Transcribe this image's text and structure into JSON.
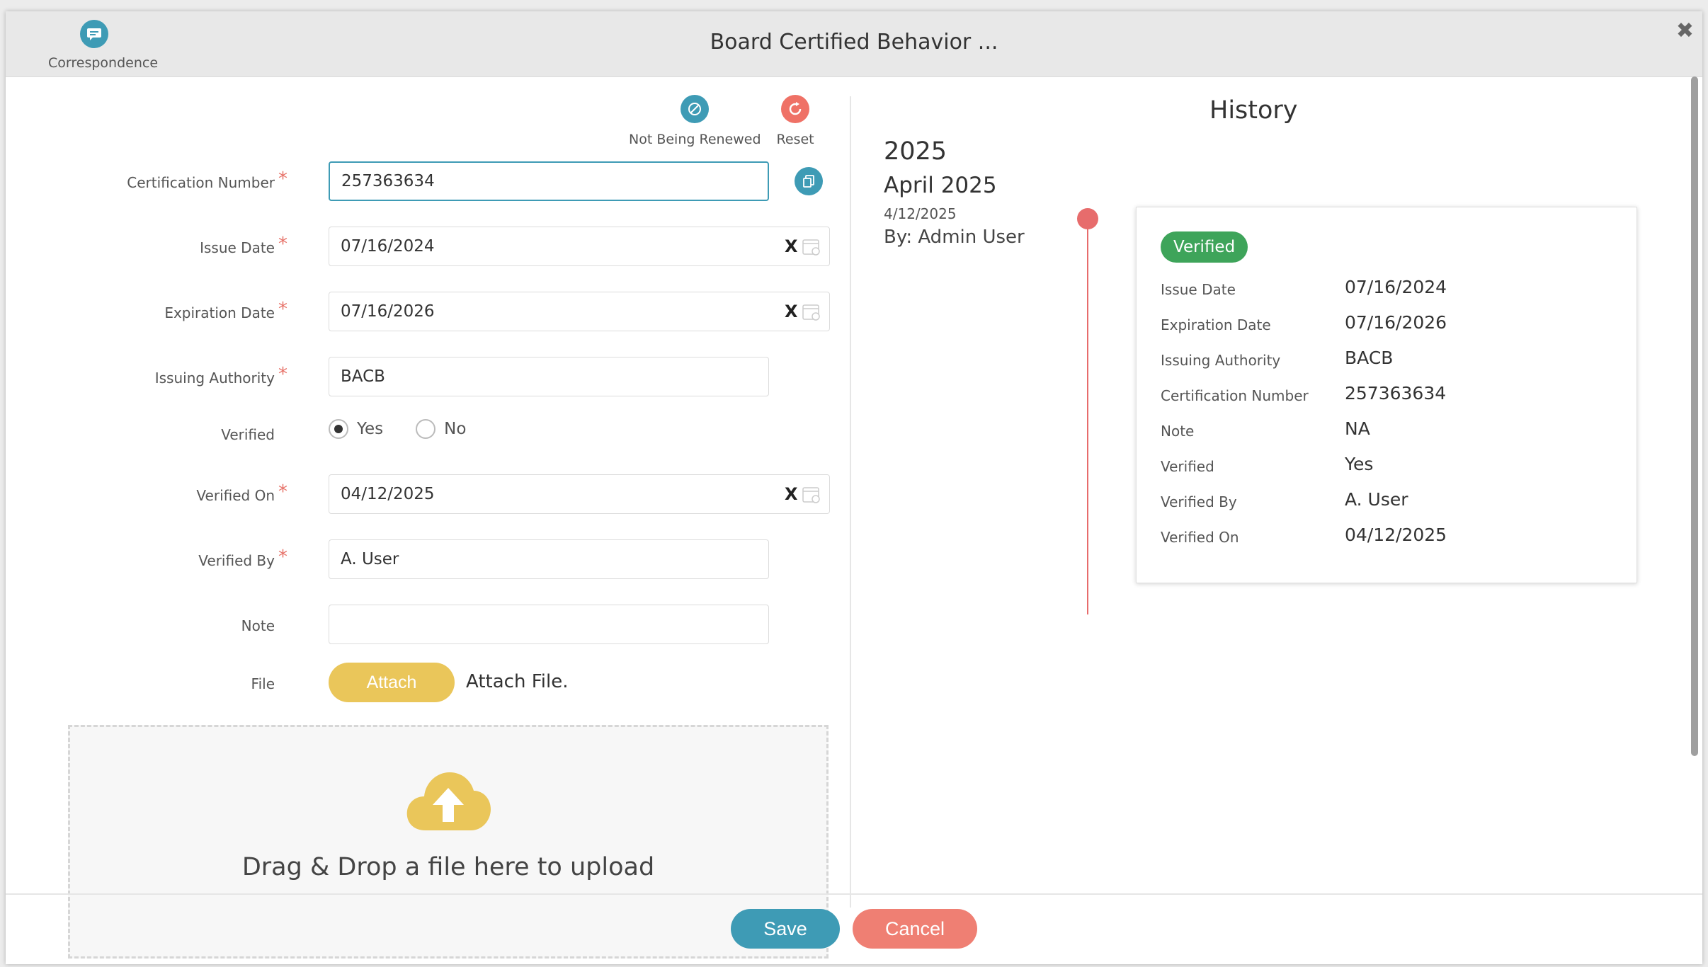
{
  "header": {
    "correspondence_label": "Correspondence",
    "title": "Board Certified Behavior ...",
    "close_icon": "close-icon"
  },
  "top_actions": {
    "not_renewed_label": "Not Being Renewed",
    "reset_label": "Reset"
  },
  "form": {
    "certification_number": {
      "label": "Certification Number",
      "value": "257363634",
      "required": "*"
    },
    "issue_date": {
      "label": "Issue Date",
      "value": "07/16/2024",
      "required": "*",
      "clear": "X"
    },
    "expiration_date": {
      "label": "Expiration Date",
      "value": "07/16/2026",
      "required": "*",
      "clear": "X"
    },
    "issuing_authority": {
      "label": "Issuing Authority",
      "value": "BACB",
      "required": "*"
    },
    "verified": {
      "label": "Verified",
      "yes": "Yes",
      "no": "No",
      "selected": "Yes"
    },
    "verified_on": {
      "label": "Verified On",
      "value": "04/12/2025",
      "required": "*",
      "clear": "X"
    },
    "verified_by": {
      "label": "Verified By",
      "value": "A. User",
      "required": "*"
    },
    "note": {
      "label": "Note",
      "value": ""
    },
    "file": {
      "label": "File",
      "attach_button": "Attach",
      "attach_text": "Attach File."
    },
    "dropzone_text": "Drag & Drop a file here to upload"
  },
  "history": {
    "title": "History",
    "year": "2025",
    "month": "April 2025",
    "date": "4/12/2025",
    "by": "By: Admin User",
    "card": {
      "status": "Verified",
      "rows": [
        {
          "key": "Issue Date",
          "value": "07/16/2024"
        },
        {
          "key": "Expiration Date",
          "value": "07/16/2026"
        },
        {
          "key": "Issuing Authority",
          "value": "BACB"
        },
        {
          "key": "Certification Number",
          "value": "257363634"
        },
        {
          "key": "Note",
          "value": "NA"
        },
        {
          "key": "Verified",
          "value": "Yes"
        },
        {
          "key": "Verified By",
          "value": "A. User"
        },
        {
          "key": "Verified On",
          "value": "04/12/2025"
        }
      ]
    }
  },
  "footer": {
    "save_label": "Save",
    "cancel_label": "Cancel"
  },
  "colors": {
    "accent": "#3e9bb5",
    "danger": "#ef7166",
    "success": "#3ea45a",
    "attach": "#eac65a",
    "timeline": "#e76c6c"
  }
}
